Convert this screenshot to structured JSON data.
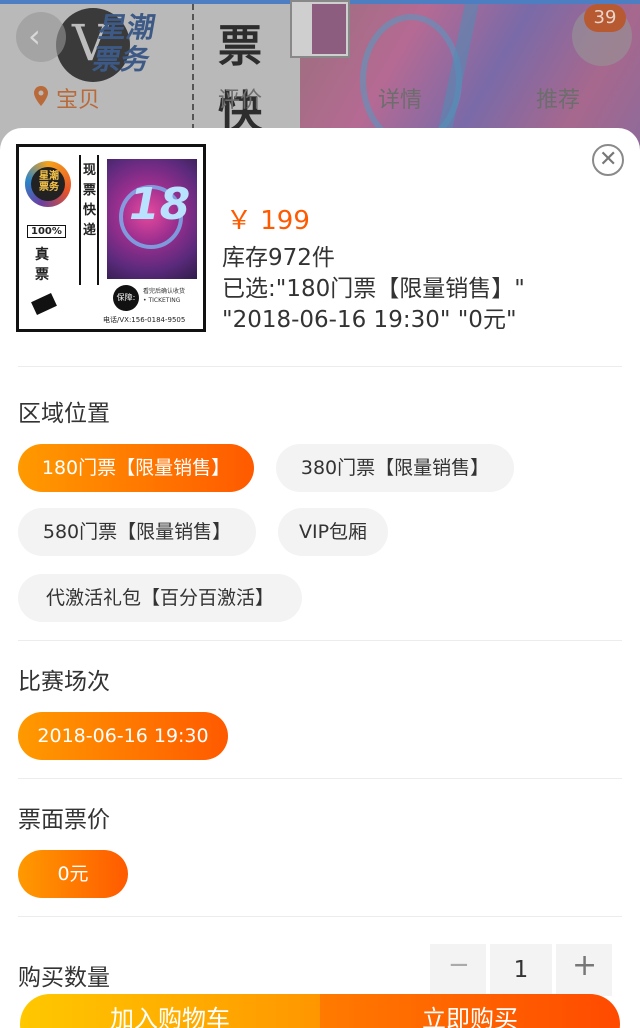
{
  "background_page": {
    "brand": "星潮\n票务",
    "big_text": "票\n快",
    "tabs": [
      "宝贝",
      "评价",
      "详情",
      "推荐"
    ],
    "active_tab": "宝贝",
    "cart_badge": "39"
  },
  "product": {
    "thumbnail": {
      "logo_text": "星潮\n票务",
      "authentic_percent": "100%",
      "authentic_text": "真\n票",
      "vertical_text": "现\n票\n快\n递",
      "poster_number": "18",
      "guarantee": "保障:",
      "ticketing": "看完后确认收货\n• TICKETING",
      "phone": "电话/VX:156-0184-9505"
    },
    "price": "￥ 199",
    "stock": "库存972件",
    "selected": "已选:\"180门票【限量销售】\"\n\"2018-06-16 19:30\" \"0元\""
  },
  "sections": {
    "area": {
      "title": "区域位置",
      "options": [
        {
          "label": "180门票【限量销售】",
          "selected": true
        },
        {
          "label": "380门票【限量销售】",
          "selected": false
        },
        {
          "label": "580门票【限量销售】",
          "selected": false
        },
        {
          "label": "VIP包厢",
          "selected": false
        },
        {
          "label": "代激活礼包【百分百激活】",
          "selected": false
        }
      ]
    },
    "session": {
      "title": "比赛场次",
      "options": [
        {
          "label": "2018-06-16 19:30",
          "selected": true
        }
      ]
    },
    "face_value": {
      "title": "票面票价",
      "options": [
        {
          "label": "0元",
          "selected": true
        }
      ]
    },
    "quantity": {
      "title": "购买数量",
      "minus": "−",
      "value": "1",
      "plus": "+"
    }
  },
  "actions": {
    "add_to_cart": "加入购物车",
    "buy_now": "立即购买"
  },
  "colors": {
    "accent_start": "#ff9a00",
    "accent_end": "#ff5a00",
    "price": "#ff5a00",
    "chip_bg": "#f3f3f3"
  },
  "icons": {
    "close": "close-icon",
    "location": "location-pin-icon",
    "back": "chevron-left-icon",
    "minus": "minus-icon",
    "plus": "plus-icon"
  }
}
